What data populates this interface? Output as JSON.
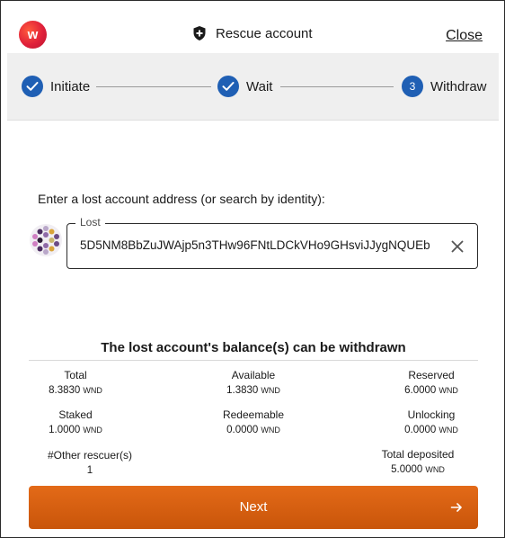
{
  "header": {
    "logo_letter": "w",
    "title": "Rescue account",
    "close_label": "Close"
  },
  "stepper": {
    "steps": [
      {
        "label": "Initiate",
        "state": "done",
        "number": ""
      },
      {
        "label": "Wait",
        "state": "done",
        "number": ""
      },
      {
        "label": "Withdraw",
        "state": "active",
        "number": "3"
      }
    ]
  },
  "lost_account": {
    "prompt": "Enter a lost account address (or search by identity):",
    "field_label": "Lost",
    "address": "5D5NM8BbZuJWAjp5n3THw96FNtLDCkVHo9GHsviJJygNQUEb"
  },
  "balances": {
    "title": "The lost account's balance(s) can be withdrawn",
    "unit": "WND",
    "total": {
      "label": "Total",
      "value": "8.3830"
    },
    "available": {
      "label": "Available",
      "value": "1.3830"
    },
    "reserved": {
      "label": "Reserved",
      "value": "6.0000"
    },
    "staked": {
      "label": "Staked",
      "value": "1.0000"
    },
    "redeemable": {
      "label": "Redeemable",
      "value": "0.0000"
    },
    "unlocking": {
      "label": "Unlocking",
      "value": "0.0000"
    },
    "other_rescuers": {
      "label": "#Other rescuer(s)",
      "value": "1"
    },
    "total_deposited": {
      "label": "Total deposited",
      "value": "5.0000"
    }
  },
  "actions": {
    "next_label": "Next"
  },
  "colors": {
    "accent_blue": "#1f5fb4",
    "button_orange": "#d85f10",
    "logo_red": "#e0203a"
  }
}
